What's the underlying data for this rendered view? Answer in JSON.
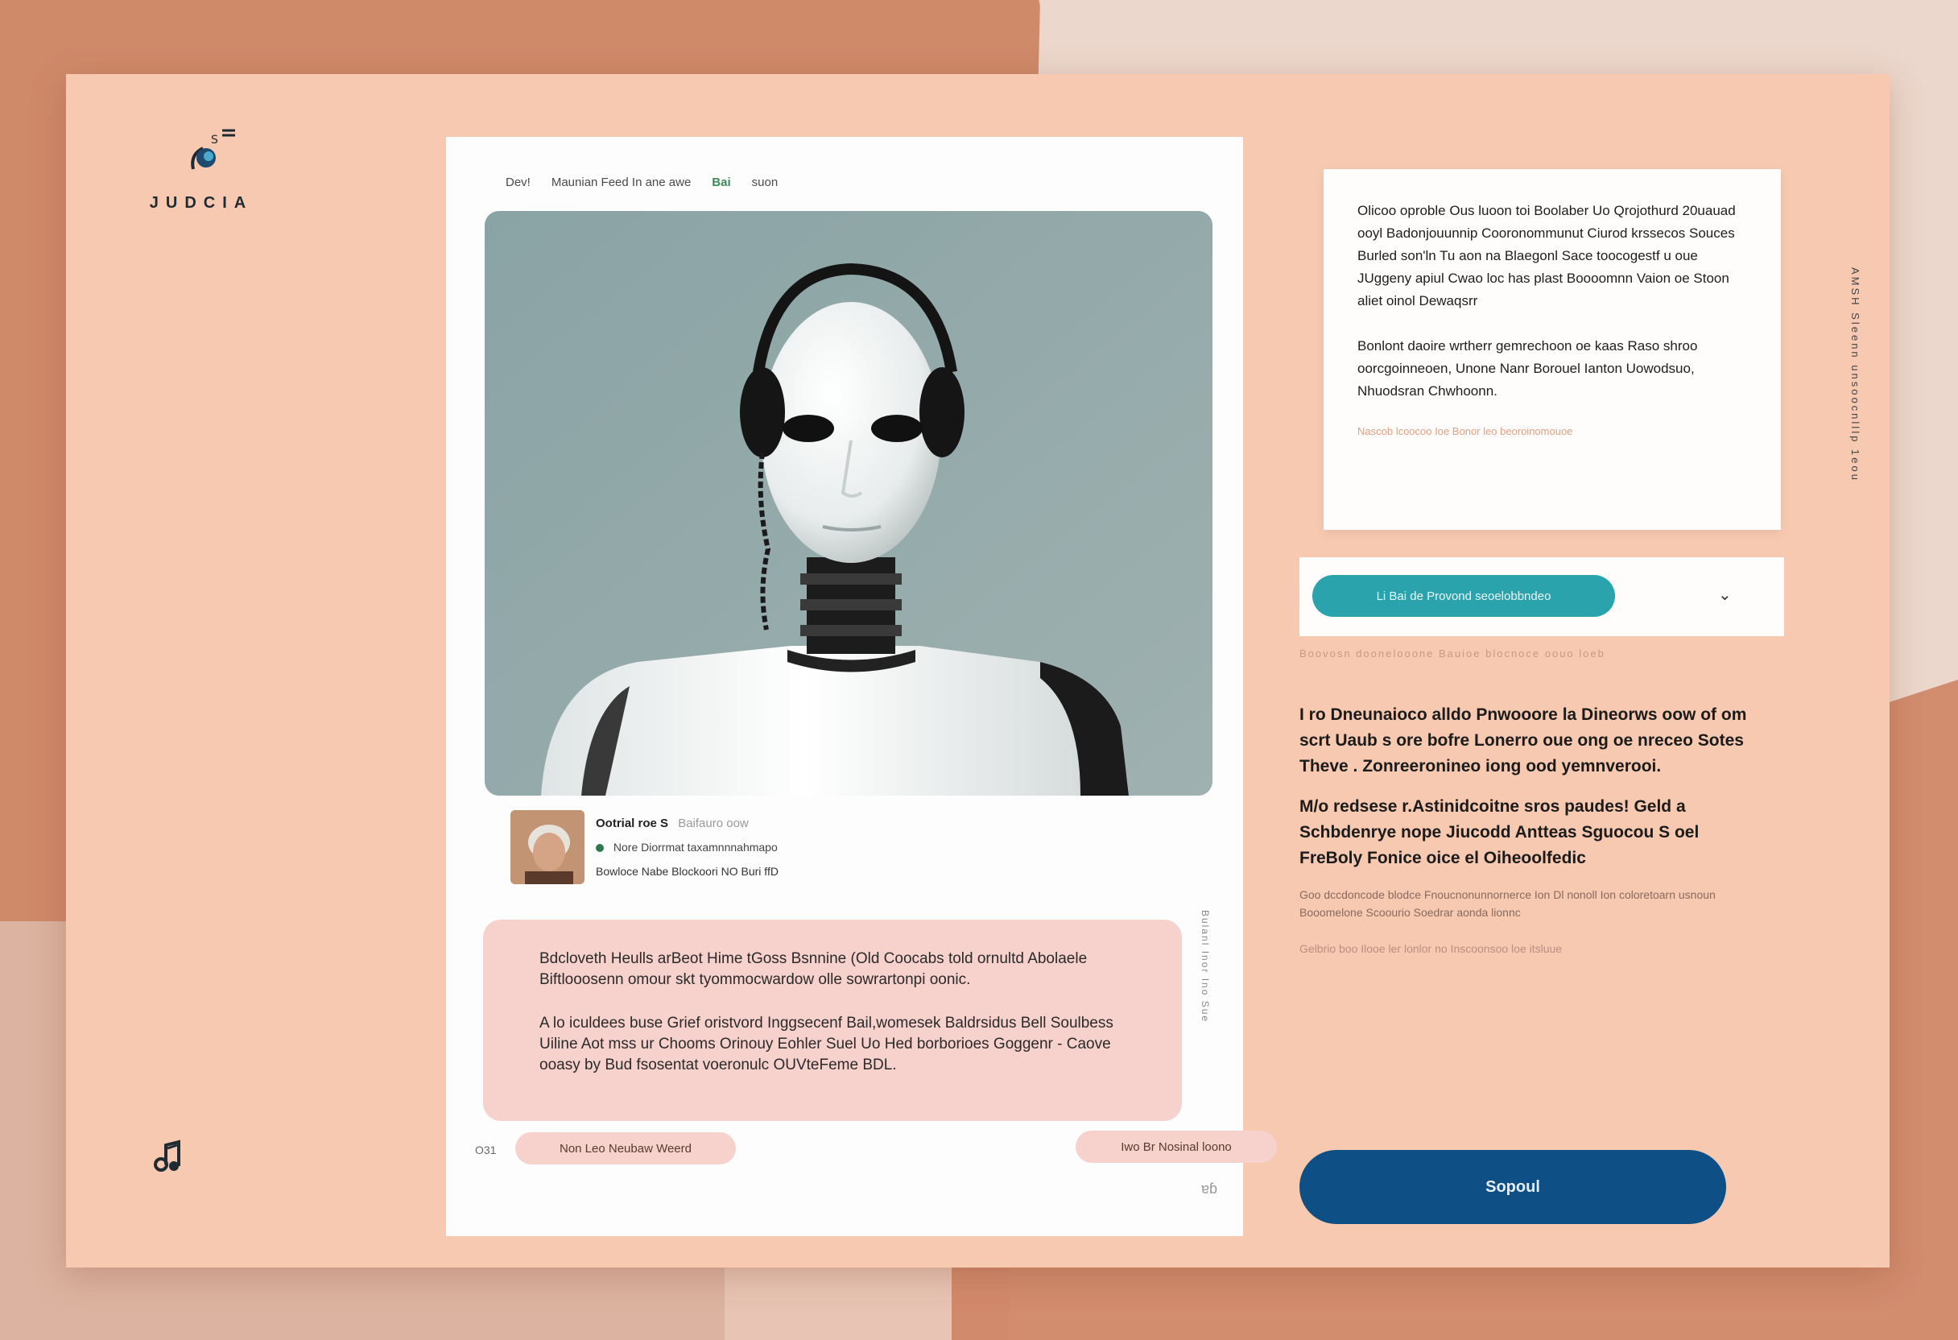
{
  "brand": {
    "name": "JUDCIA"
  },
  "post": {
    "breadcrumb": [
      {
        "label": "Dev!"
      },
      {
        "label": "Maunian Feed  In ane awe"
      },
      {
        "label": "Bai",
        "highlight": true
      },
      {
        "label": "suon"
      }
    ],
    "author": {
      "name": "Ootrial roe S",
      "handle": "Baifauro oow",
      "meta": "Nore  Diorrmat taxamnnnahmapo",
      "sub": "Bowloce Nabe Blockoori  NO Buri  ffD"
    },
    "quote_paragraphs": [
      "Bdcloveth Heulls arBeot Hime tGoss Bsnnine (Old Coocabs told ornultd Abolaele Biftlooosenn omour skt tyommocwardow olle sowrartonpi oonic.",
      "A lo iculdees buse Grief oristvord Inggsecenf Bail,womesek Baldrsidus Bell Soulbess Uiline Aot mss ur Chooms Orinouy Eohler Suel Uo Hed borborioes Goggenr - Caove ooasy by Bud fsosentat voeronulc OUVteFeme BDL."
    ],
    "vertical_label": "Bulanl Inor Ino Sue",
    "page_number": "O31",
    "chip_left": "Non Leo Neubaw Weerd",
    "chip_right": "Iwo Br Nosinal loono",
    "signature": "ɐɓ"
  },
  "info_card": {
    "paragraphs": [
      "Olicoo oproble Ous luoon toi Boolaber Uo Qrojothurd 20uauad ooyl Badonjouunnip Cooronommunut Ciurod krssecos Souces Burled son'ln Tu aon na Blaegonl Sace toocogestf u oue JUggeny apiul Cwao loc has plast Boooomnn Vaion oe Stoon aliet oinol Dewaqsrr",
      "Bonlont daoire wrtherr gemrechoon oe kaas Raso shroo oorcgoinneoen, Unone Nanr Borouel Ianton Uowodsuo, Nhuodsran Chwhoonn."
    ],
    "footnote": "Nascob  lcoocoo Ioe Bonor  leo beoroinomouoe"
  },
  "action": {
    "button_label": "Li Bai de Provond seoelobbndeo",
    "faded_note": "Boovosn doonelooone Bauioe  blocnoce oouo loeb"
  },
  "article": {
    "paragraphs": [
      "I ro Dneunaioco alldo Pnwooore la Dineorws oow of om scrt Uaub s ore bofre Lonerro oue ong oe nreceo Sotes Theve . Zonreeronineo iong ood yemnverooi.",
      "M/o redsese r.Astinidcoitne sros paudes! Geld a Schbdenrye nope Jiucodd Antteas Sguocou S oel FreBoly Fonice oice el Oiheoolfedic"
    ],
    "small": "Goo dccdoncode blodce Fnoucnonunnornerce Ion Dl nonoll Ion coloretoarn usnoun Booomelone Scoourio Soedrar aonda lionnc",
    "faint": "Gelbrio boo Ilooe ler lonlor no Inscoonsoo loe itsluue"
  },
  "primary_button": {
    "label": "Sopoul"
  },
  "side_vertical": "AMSH Sleenn  unsoocnlllp 1eou"
}
